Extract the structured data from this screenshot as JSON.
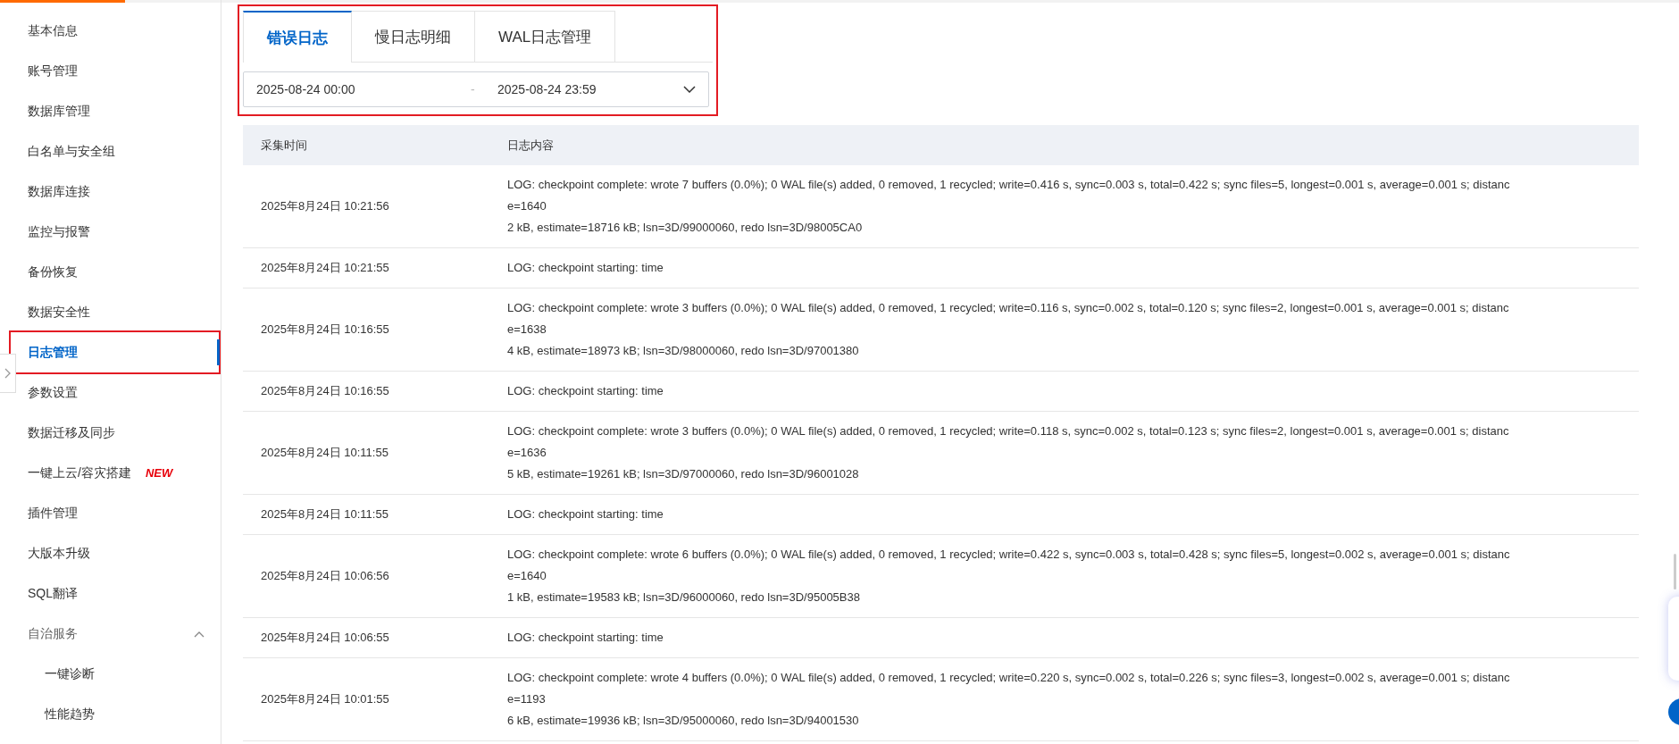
{
  "sidebar": {
    "items": [
      {
        "label": "基本信息",
        "selected": false,
        "kind": "item"
      },
      {
        "label": "账号管理",
        "selected": false,
        "kind": "item"
      },
      {
        "label": "数据库管理",
        "selected": false,
        "kind": "item"
      },
      {
        "label": "白名单与安全组",
        "selected": false,
        "kind": "item"
      },
      {
        "label": "数据库连接",
        "selected": false,
        "kind": "item"
      },
      {
        "label": "监控与报警",
        "selected": false,
        "kind": "item"
      },
      {
        "label": "备份恢复",
        "selected": false,
        "kind": "item"
      },
      {
        "label": "数据安全性",
        "selected": false,
        "kind": "item"
      },
      {
        "label": "日志管理",
        "selected": true,
        "kind": "item"
      },
      {
        "label": "参数设置",
        "selected": false,
        "kind": "item"
      },
      {
        "label": "数据迁移及同步",
        "selected": false,
        "kind": "item"
      },
      {
        "label": "一键上云/容灾搭建",
        "selected": false,
        "kind": "item",
        "badge": "NEW"
      },
      {
        "label": "插件管理",
        "selected": false,
        "kind": "item"
      },
      {
        "label": "大版本升级",
        "selected": false,
        "kind": "item"
      },
      {
        "label": "SQL翻译",
        "selected": false,
        "kind": "item"
      },
      {
        "label": "自治服务",
        "kind": "group",
        "expanded": true,
        "children": [
          {
            "label": "一键诊断",
            "selected": false,
            "kind": "item"
          },
          {
            "label": "性能趋势",
            "selected": false,
            "kind": "item"
          }
        ]
      }
    ]
  },
  "tabs": [
    {
      "label": "错误日志",
      "selected": true
    },
    {
      "label": "慢日志明细",
      "selected": false
    },
    {
      "label": "WAL日志管理",
      "selected": false
    }
  ],
  "date_range": {
    "start": "2025-08-24 00:00",
    "separator": "-",
    "end": "2025-08-24 23:59"
  },
  "table": {
    "columns": [
      "采集时间",
      "日志内容"
    ],
    "rows": [
      {
        "time": "2025年8月24日 10:21:56",
        "content": [
          "LOG: checkpoint complete: wrote 7 buffers (0.0%); 0 WAL file(s) added, 0 removed, 1 recycled; write=0.416 s, sync=0.003 s, total=0.422 s; sync files=5, longest=0.001 s, average=0.001 s; distanc",
          "e=1640",
          "2 kB, estimate=18716 kB; lsn=3D/99000060, redo lsn=3D/98005CA0"
        ]
      },
      {
        "time": "2025年8月24日 10:21:55",
        "content": [
          "LOG: checkpoint starting: time"
        ]
      },
      {
        "time": "2025年8月24日 10:16:55",
        "content": [
          "LOG: checkpoint complete: wrote 3 buffers (0.0%); 0 WAL file(s) added, 0 removed, 1 recycled; write=0.116 s, sync=0.002 s, total=0.120 s; sync files=2, longest=0.001 s, average=0.001 s; distanc",
          "e=1638",
          "4 kB, estimate=18973 kB; lsn=3D/98000060, redo lsn=3D/97001380"
        ]
      },
      {
        "time": "2025年8月24日 10:16:55",
        "content": [
          "LOG: checkpoint starting: time"
        ]
      },
      {
        "time": "2025年8月24日 10:11:55",
        "content": [
          "LOG: checkpoint complete: wrote 3 buffers (0.0%); 0 WAL file(s) added, 0 removed, 1 recycled; write=0.118 s, sync=0.002 s, total=0.123 s; sync files=2, longest=0.001 s, average=0.001 s; distanc",
          "e=1636",
          "5 kB, estimate=19261 kB; lsn=3D/97000060, redo lsn=3D/96001028"
        ]
      },
      {
        "time": "2025年8月24日 10:11:55",
        "content": [
          "LOG: checkpoint starting: time"
        ]
      },
      {
        "time": "2025年8月24日 10:06:56",
        "content": [
          "LOG: checkpoint complete: wrote 6 buffers (0.0%); 0 WAL file(s) added, 0 removed, 1 recycled; write=0.422 s, sync=0.003 s, total=0.428 s; sync files=5, longest=0.002 s, average=0.001 s; distanc",
          "e=1640",
          "1 kB, estimate=19583 kB; lsn=3D/96000060, redo lsn=3D/95005B38"
        ]
      },
      {
        "time": "2025年8月24日 10:06:55",
        "content": [
          "LOG: checkpoint starting: time"
        ]
      },
      {
        "time": "2025年8月24日 10:01:55",
        "content": [
          "LOG: checkpoint complete: wrote 4 buffers (0.0%); 0 WAL file(s) added, 0 removed, 1 recycled; write=0.220 s, sync=0.002 s, total=0.226 s; sync files=3, longest=0.002 s, average=0.001 s; distanc",
          "e=1193",
          "6 kB, estimate=19936 kB; lsn=3D/95000060, redo lsn=3D/94001530"
        ]
      }
    ]
  }
}
